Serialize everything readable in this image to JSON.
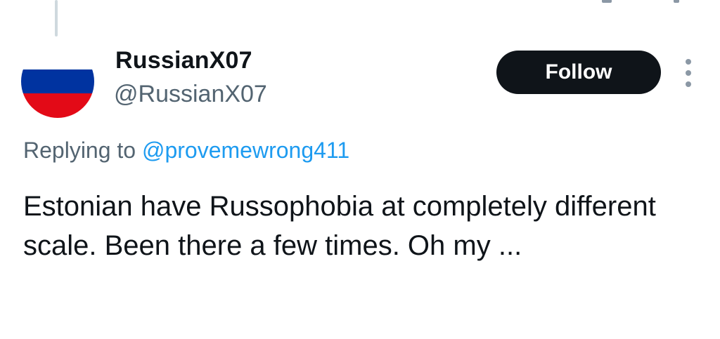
{
  "tweet": {
    "author": {
      "display_name": "RussianX07",
      "handle": "@RussianX07",
      "avatar_icon": "russia-flag-avatar",
      "avatar_colors": [
        "#ffffff",
        "#0033a0",
        "#e30a17"
      ]
    },
    "follow_label": "Follow",
    "more_icon": "more-vertical-icon",
    "replying_to_prefix": "Replying to",
    "replying_to_handle": "@provemewrong411",
    "text": "Estonian have Russophobia at completely different scale. Been there a few times. Oh my ..."
  },
  "colors": {
    "text": "#0f1419",
    "secondary": "#536471",
    "link": "#1d9bf0",
    "button_bg": "#0f1419",
    "thread_line": "#cfd9de"
  }
}
